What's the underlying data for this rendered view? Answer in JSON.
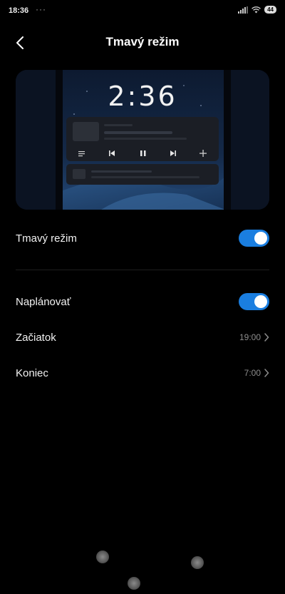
{
  "status_bar": {
    "time": "18:36",
    "overflow_dots": "···",
    "battery_level": "44",
    "icons": [
      "signal-icon",
      "wifi-icon",
      "battery-icon"
    ]
  },
  "header": {
    "title": "Tmavý režim",
    "back_icon": "chevron-left-icon"
  },
  "preview": {
    "clock": "2:36",
    "media_controls": [
      "menu-icon",
      "previous-icon",
      "pause-icon",
      "next-icon",
      "add-icon"
    ]
  },
  "settings": {
    "dark_mode": {
      "label": "Tmavý režim",
      "enabled": true
    },
    "schedule": {
      "label": "Naplánovať",
      "enabled": true
    },
    "start": {
      "label": "Začiatok",
      "value": "19:00"
    },
    "end": {
      "label": "Koniec",
      "value": "7:00"
    }
  },
  "colors": {
    "accent": "#1a7ee0",
    "background": "#000000",
    "secondary_text": "#8d8d8d"
  }
}
